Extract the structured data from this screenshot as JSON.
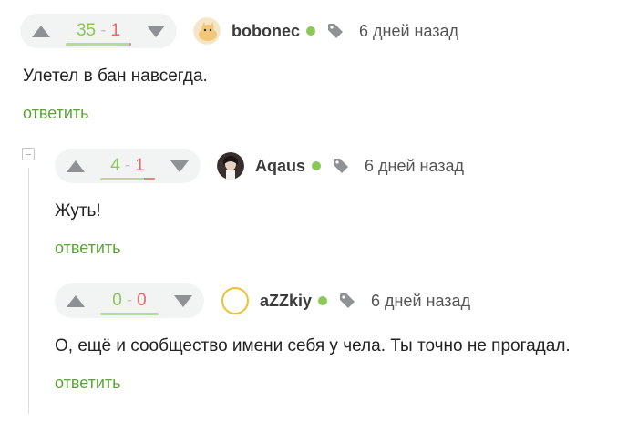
{
  "comments": [
    {
      "rating": {
        "plus": "35",
        "sep": "-",
        "minus": "1",
        "negative_fraction": 0.03
      },
      "author": "bobonec",
      "time": "6 дней назад",
      "text": "Улетел в бан навсегда.",
      "reply_label": "ответить",
      "avatar_icon": "cat-avatar-icon"
    },
    {
      "rating": {
        "plus": "4",
        "sep": "-",
        "minus": "1",
        "negative_fraction": 0.2
      },
      "author": "Aqaus",
      "time": "6 дней назад",
      "text": "Жуть!",
      "reply_label": "ответить",
      "avatar_icon": "character-avatar-icon"
    },
    {
      "rating": {
        "plus": "0",
        "sep": "-",
        "minus": "0",
        "negative_fraction": 0
      },
      "author": "aZZkiy",
      "time": "6 дней назад",
      "text": "О, ещё и сообщество имени себя у чела. Ты точно не прогадал.",
      "reply_label": "ответить",
      "avatar_icon": "empty-avatar-icon"
    }
  ],
  "colors": {
    "online": "#8ac858",
    "plus": "#8ac858",
    "minus": "#e86a6a",
    "reply": "#5da238"
  }
}
